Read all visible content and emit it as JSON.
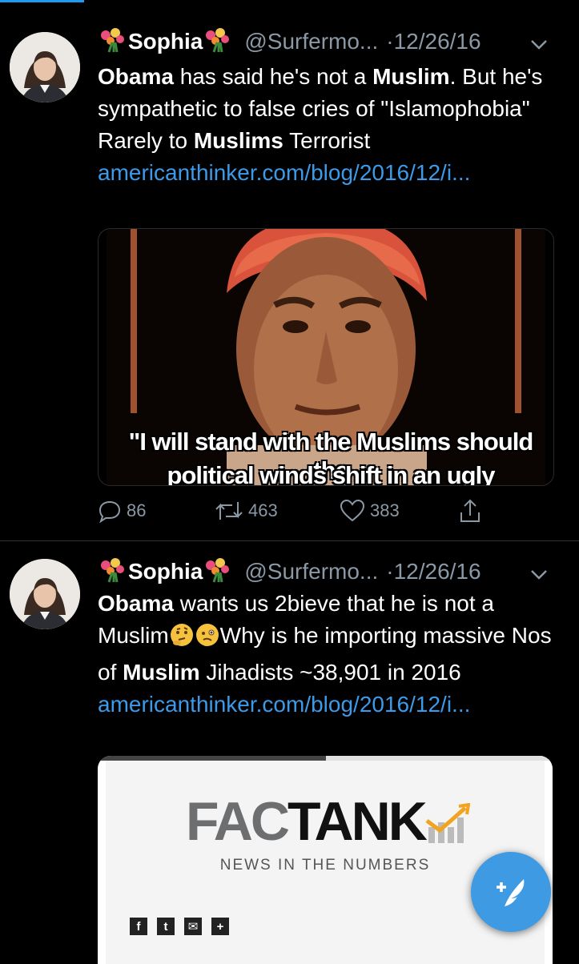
{
  "tweets": [
    {
      "name": "Sophia",
      "handle": "@Surfermo...",
      "date": "·12/26/16",
      "body_parts": [
        "Obama",
        " has said he's not a ",
        "Muslim",
        ". But he's sympathetic to false cries of \"Islamophobia\" Rarely to ",
        "Muslims",
        " Terrorist"
      ],
      "link": "americanthinker.com/blog/2016/12/i...",
      "image_quote_line1": "\"I will stand with the Muslims should the",
      "image_quote_line2": "political winds shift in an ugly direction.\"",
      "replies": "86",
      "retweets": "463",
      "likes": "383"
    },
    {
      "name": "Sophia",
      "handle": "@Surfermo...",
      "date": "·12/26/16",
      "body_parts": [
        "Obama",
        " wants us 2bieve that he is not a Muslim",
        "Why is he importing massive Nos of ",
        "Muslim",
        " Jihadists ~38,901 in 2016"
      ],
      "link": "americanthinker.com/blog/2016/12/i...",
      "card_brand_part1": "FAC",
      "card_brand_part2": "TANK",
      "card_tagline": "NEWS IN THE NUMBERS",
      "card_share_icons": [
        "f",
        "t",
        "✉",
        "+"
      ]
    }
  ],
  "colors": {
    "background": "#000000",
    "link": "#3c9ae8",
    "muted": "#8b98a5",
    "fab": "#3f9ae4"
  },
  "icons": [
    "flower-emoji-icon",
    "chevron-down-icon",
    "reply-icon",
    "retweet-icon",
    "like-icon",
    "share-icon",
    "thinking-face-icon",
    "confused-face-icon",
    "compose-tweet-icon"
  ]
}
